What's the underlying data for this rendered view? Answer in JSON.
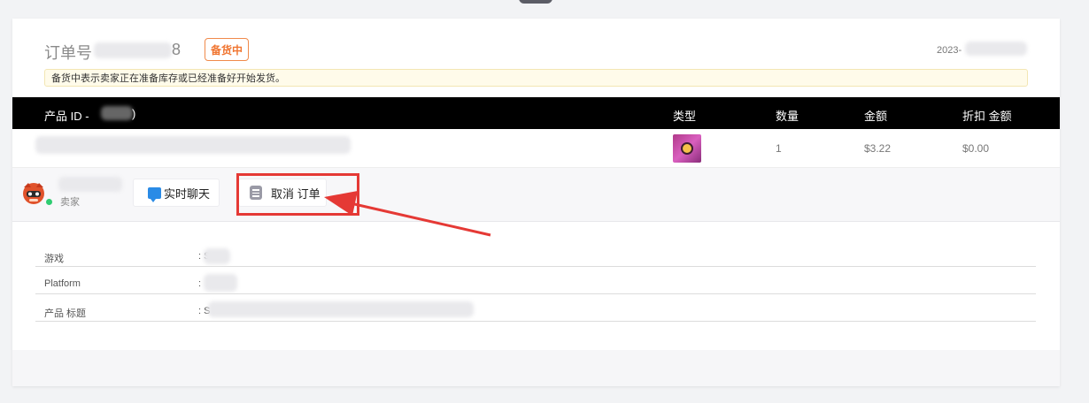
{
  "order": {
    "label": "订单号",
    "number_tail": "8",
    "status": "备货中",
    "date": "2023-",
    "notice": "备货中表示卖家正在准备库存或已经准备好开始发货。"
  },
  "table": {
    "headers": {
      "product_id": "产品 ID -",
      "product_id_suffix": ")",
      "type": "类型",
      "quantity": "数量",
      "amount": "金额",
      "discount": "折扣 金额"
    },
    "rows": [
      {
        "quantity": "1",
        "amount": "$3.22",
        "discount": "$0.00"
      }
    ]
  },
  "seller": {
    "role": "卖家",
    "chat_label": "实时聊天",
    "cancel_label": "取消 订单"
  },
  "details": [
    {
      "key": "游戏",
      "value": ": S"
    },
    {
      "key": "Platform",
      "value": ": "
    },
    {
      "key": "产品 标题",
      "value": ": S"
    }
  ],
  "colors": {
    "status": "#f07530",
    "annotation": "#e53935",
    "online": "#2ecc71",
    "header_bg": "#000000"
  },
  "icons": [
    "chat-icon",
    "document-icon",
    "seller-avatar-icon",
    "annotation-arrow"
  ]
}
